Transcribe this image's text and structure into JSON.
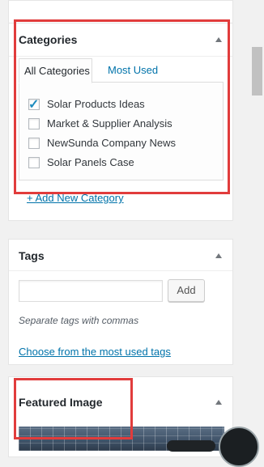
{
  "categories": {
    "title": "Categories",
    "tabs": [
      "All Categories",
      "Most Used"
    ],
    "items": [
      {
        "label": "Solar Products Ideas",
        "checked": true
      },
      {
        "label": "Market & Supplier Analysis",
        "checked": false
      },
      {
        "label": "NewSunda Company News",
        "checked": false
      },
      {
        "label": "Solar Panels Case",
        "checked": false
      }
    ],
    "add_new": "+ Add New Category"
  },
  "tags": {
    "title": "Tags",
    "input_value": "",
    "add_button": "Add",
    "hint": "Separate tags with commas",
    "choose_link": "Choose from the most used tags"
  },
  "featured": {
    "title": "Featured Image"
  },
  "colors": {
    "highlight": "#e13c3c",
    "link": "#0073aa",
    "check": "#1e8cbe"
  }
}
